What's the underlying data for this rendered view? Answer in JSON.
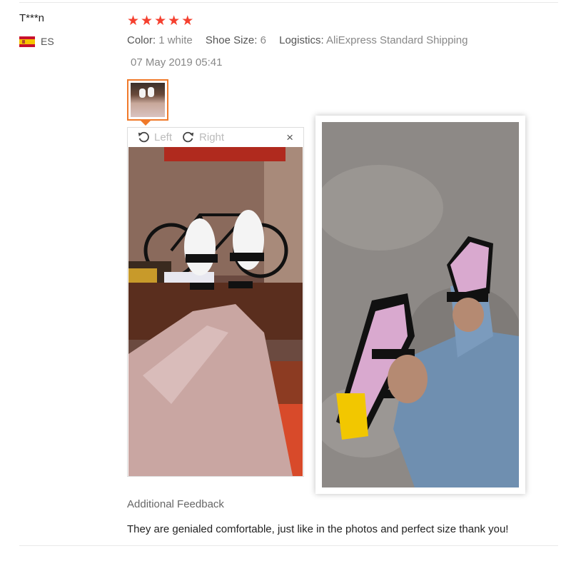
{
  "review": {
    "user_name": "T***n",
    "country_code": "ES",
    "rating": 5,
    "stars": [
      "★",
      "★",
      "★",
      "★",
      "★"
    ],
    "color_label": "Color:",
    "color_value": "1 white",
    "size_label": "Shoe Size:",
    "size_value": "6",
    "logistics_label": "Logistics:",
    "logistics_value": "AliExpress Standard Shipping",
    "date": "07 May 2019 05:41"
  },
  "viewer": {
    "rotate_left_label": "Left",
    "rotate_right_label": "Right",
    "close_glyph": "×"
  },
  "feedback": {
    "title": "Additional Feedback",
    "text": "They are genialed comfortable, just like in the photos and perfect size thank you!"
  },
  "colors": {
    "star": "#f5402f",
    "thumb_border": "#f07a2a"
  }
}
